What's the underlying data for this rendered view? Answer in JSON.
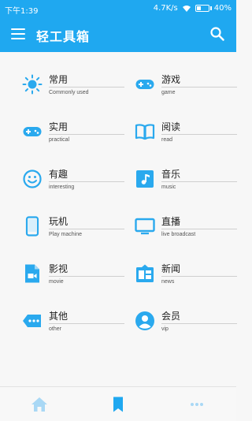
{
  "status_bar": {
    "time": "下午1:39",
    "network_speed": "4.7K/s",
    "battery_percent": 40,
    "battery_label": "40%"
  },
  "appbar": {
    "title": "轻工具箱",
    "menu_icon": "menu-icon",
    "search_icon": "search-icon",
    "color": "#1fa8f0"
  },
  "categories": [
    {
      "zh": "常用",
      "en": "Commonly used",
      "icon": "sun-icon"
    },
    {
      "zh": "游戏",
      "en": "game",
      "icon": "gamepad-icon"
    },
    {
      "zh": "实用",
      "en": "practical",
      "icon": "gamepad-icon"
    },
    {
      "zh": "阅读",
      "en": "read",
      "icon": "book-icon"
    },
    {
      "zh": "有趣",
      "en": "interesting",
      "icon": "smiley-icon"
    },
    {
      "zh": "音乐",
      "en": "music",
      "icon": "music-note-icon"
    },
    {
      "zh": "玩机",
      "en": "Play machine",
      "icon": "phone-icon"
    },
    {
      "zh": "直播",
      "en": "live broadcast",
      "icon": "tv-icon"
    },
    {
      "zh": "影视",
      "en": "movie",
      "icon": "video-file-icon"
    },
    {
      "zh": "新闻",
      "en": "news",
      "icon": "news-icon"
    },
    {
      "zh": "其他",
      "en": "other",
      "icon": "more-tag-icon"
    },
    {
      "zh": "会员",
      "en": "vip",
      "icon": "account-icon"
    }
  ],
  "bottom_nav": [
    {
      "icon": "home-icon"
    },
    {
      "icon": "bookmark-icon",
      "active": true
    },
    {
      "icon": "more-dots-icon"
    }
  ],
  "colors": {
    "accent": "#1fa8f0",
    "icon_blue": "#2aa9ee",
    "inactive_tab": "#a9d8f5"
  }
}
